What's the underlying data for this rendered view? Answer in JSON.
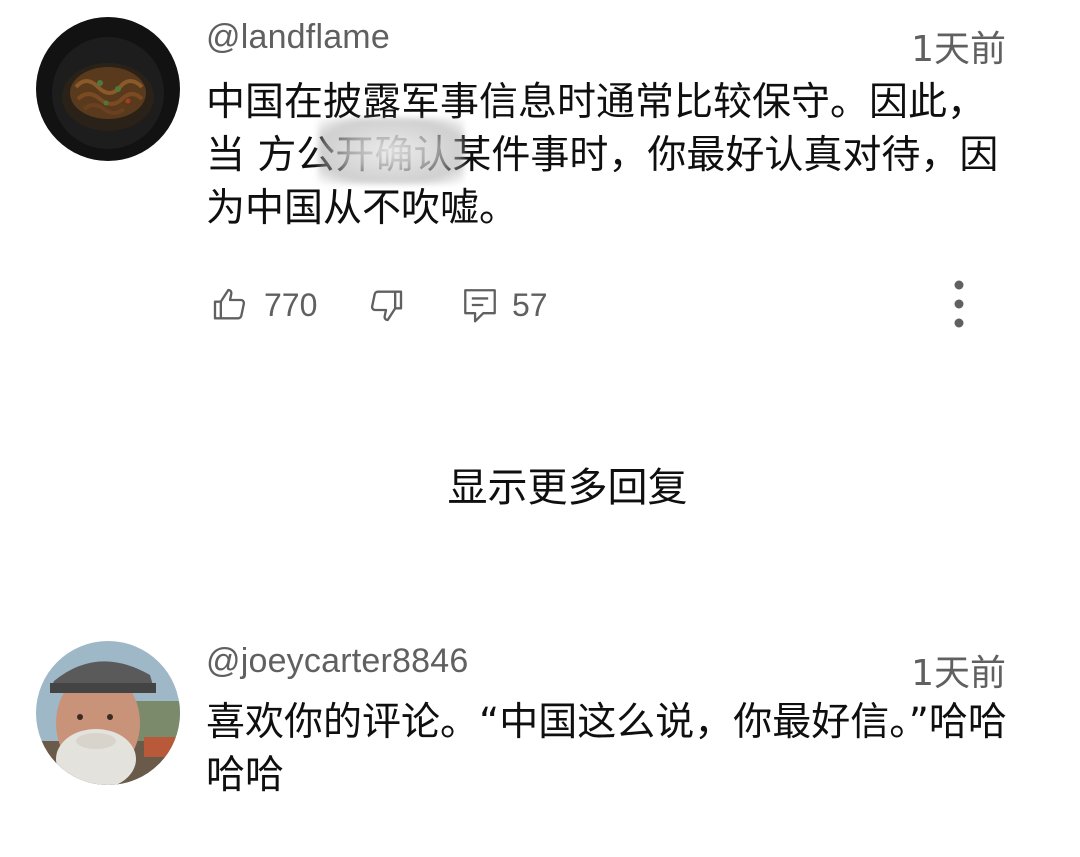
{
  "comments": [
    {
      "handle": "@landflame",
      "time": "1天前",
      "text": "中国在披露军事信息时通常比较保守。因此，当    方公开确认某件事时，你最好认真对待，因为中国从不吹嘘。",
      "likes": "770",
      "replies": "57"
    },
    {
      "handle": "@joeycarter8846",
      "time": "1天前",
      "text": "喜欢你的评论。“中国这么说，你最好信。”哈哈哈哈"
    }
  ],
  "show_more_replies": "显示更多回复",
  "icons": {
    "like": "thumbs-up-icon",
    "dislike": "thumbs-down-icon",
    "reply": "comment-icon",
    "more": "more-vert-icon"
  },
  "colors": {
    "text": "#0f0f0f",
    "secondary": "#606060",
    "background": "#ffffff"
  }
}
